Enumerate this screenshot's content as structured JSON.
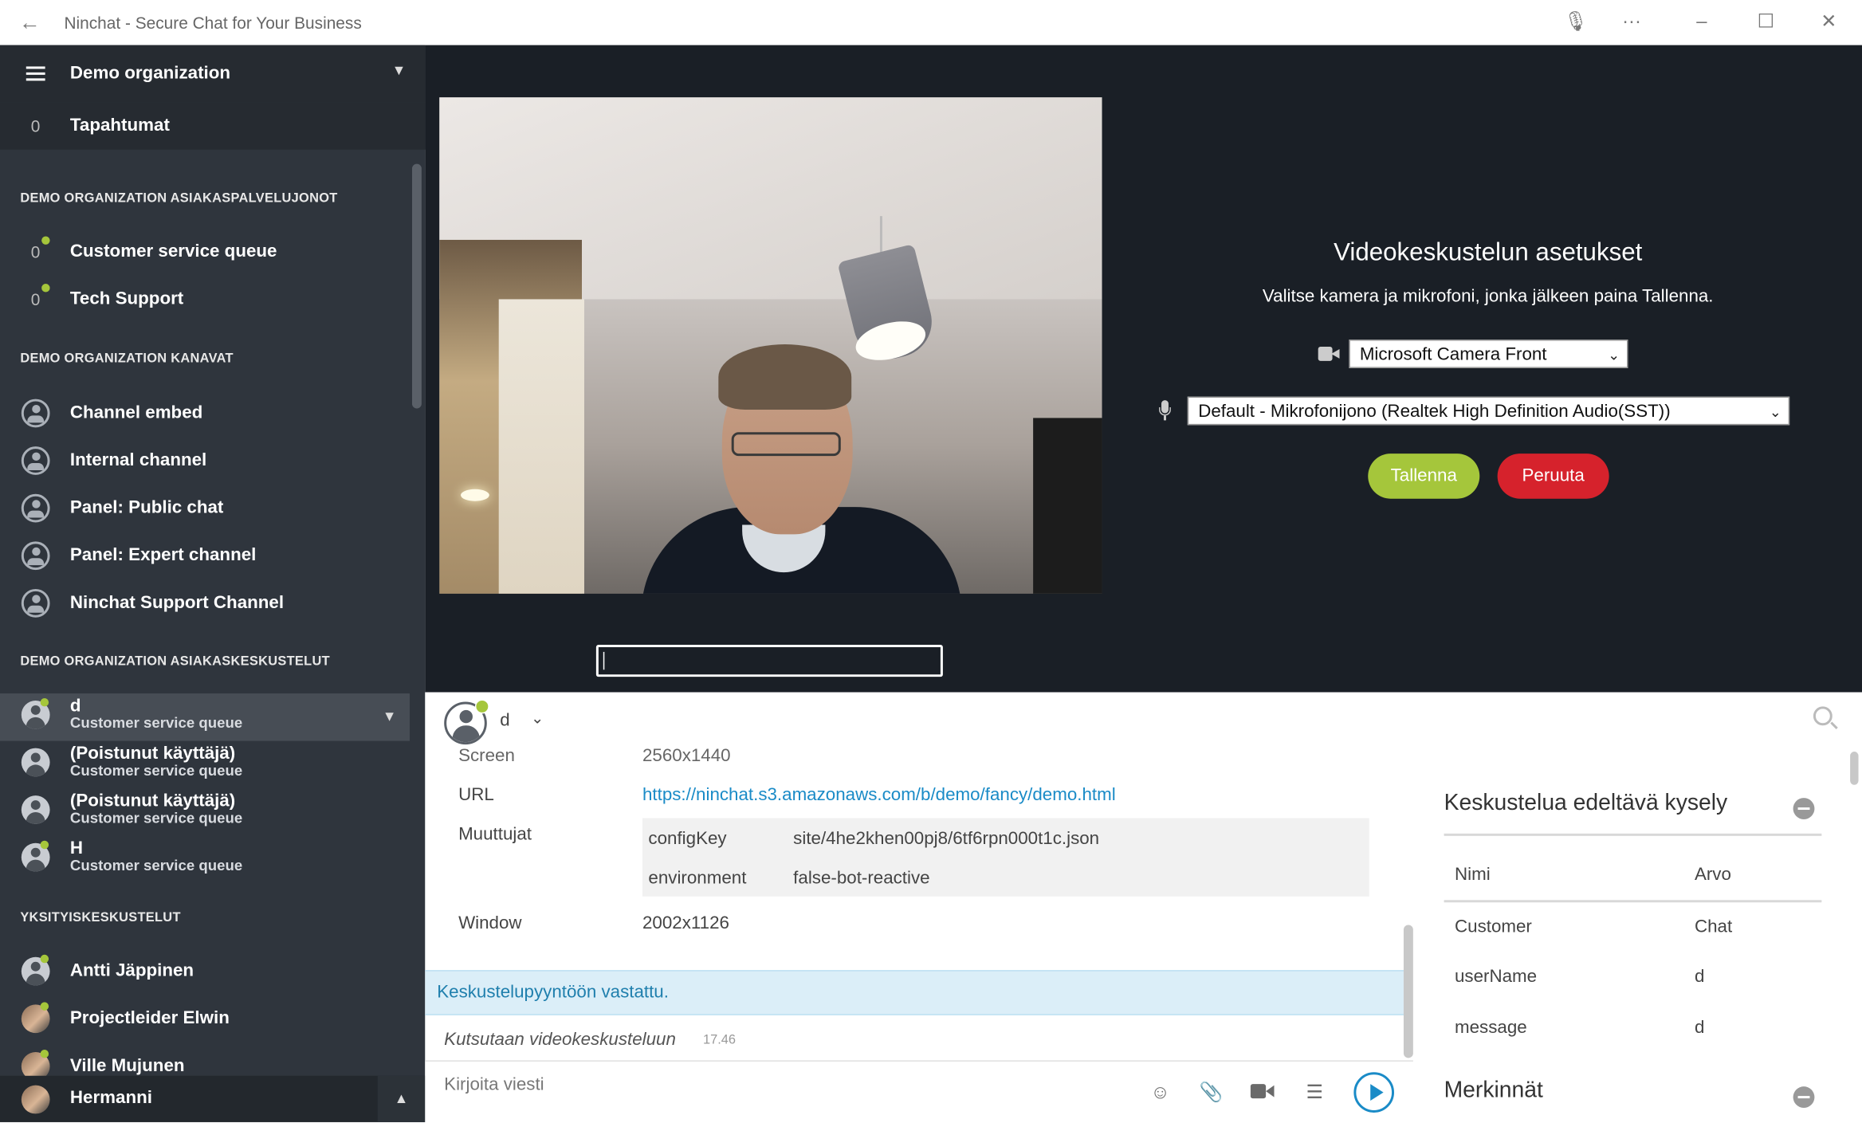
{
  "window": {
    "title": "Ninchat - Secure Chat for Your Business"
  },
  "sidebar": {
    "org_name": "Demo organization",
    "events": {
      "count": "0",
      "label": "Tapahtumat"
    },
    "queues_heading": "DEMO ORGANIZATION ASIAKASPALVELUJONOT",
    "queues": [
      {
        "count": "0",
        "label": "Customer service queue"
      },
      {
        "count": "0",
        "label": "Tech Support"
      }
    ],
    "channels_heading": "DEMO ORGANIZATION KANAVAT",
    "channels": [
      {
        "label": "Channel embed"
      },
      {
        "label": "Internal channel"
      },
      {
        "label": "Panel: Public chat"
      },
      {
        "label": "Panel: Expert channel"
      },
      {
        "label": "Ninchat Support Channel"
      }
    ],
    "conversations_heading": "DEMO ORGANIZATION ASIAKASKESKUSTELUT",
    "conversations": [
      {
        "name": "d",
        "sub": "Customer service queue"
      },
      {
        "name": "(Poistunut käyttäjä)",
        "sub": "Customer service queue"
      },
      {
        "name": "(Poistunut käyttäjä)",
        "sub": "Customer service queue"
      },
      {
        "name": "H",
        "sub": "Customer service queue"
      }
    ],
    "private_heading": "YKSITYISKESKUSTELUT",
    "private": [
      {
        "label": "Antti Jäppinen"
      },
      {
        "label": "Projectleider Elwin"
      },
      {
        "label": "Ville Mujunen"
      }
    ],
    "current_user": "Hermanni"
  },
  "video_settings": {
    "heading": "Videokeskustelun asetukset",
    "subtitle": "Valitse kamera ja mikrofoni, jonka jälkeen paina Tallenna.",
    "camera": "Microsoft Camera Front",
    "microphone": "Default - Mikrofonijono (Realtek High Definition Audio(SST))",
    "save_label": "Tallenna",
    "cancel_label": "Peruuta"
  },
  "chat": {
    "user": "d",
    "info": {
      "screen_label": "Screen",
      "screen_value": "2560x1440",
      "url_label": "URL",
      "url_value": "https://ninchat.s3.amazonaws.com/b/demo/fancy/demo.html",
      "vars_label": "Muuttujat",
      "vars": [
        {
          "key": "configKey",
          "value": "site/4he2khen00pj8/6tf6rpn000t1c.json"
        },
        {
          "key": "environment",
          "value": "false-bot-reactive"
        }
      ],
      "window_label": "Window",
      "window_value": "2002x1126"
    },
    "system_message": "Keskustelupyyntöön vastattu.",
    "italic_message": "Kutsutaan videokeskusteluun",
    "time": "17.46",
    "composer_placeholder": "Kirjoita viesti"
  },
  "pre_survey": {
    "title": "Keskustelua edeltävä kysely",
    "col_name": "Nimi",
    "col_value": "Arvo",
    "rows": [
      {
        "name": "Customer",
        "value": "Chat"
      },
      {
        "name": "userName",
        "value": "d"
      },
      {
        "name": "message",
        "value": "d"
      }
    ],
    "notes_title": "Merkinnät"
  },
  "colors": {
    "sidebar_bg": "#2f353d",
    "accent_green": "#a5c63b",
    "cancel_red": "#d6222c",
    "link_blue": "#1a8bc7"
  }
}
